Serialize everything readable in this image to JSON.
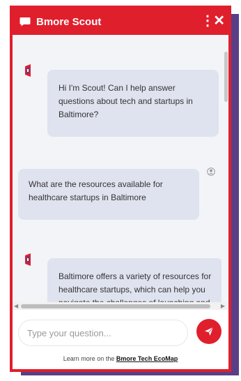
{
  "header": {
    "title": "Bmore Scout",
    "kebab": "⋮",
    "close": "✕",
    "color": "#e01f2d"
  },
  "messages": [
    {
      "role": "bot",
      "text": "Hi I'm Scout! Can I help answer questions about tech and startups in Baltimore?"
    },
    {
      "role": "user",
      "text": "What are the resources available for healthcare startups in Baltimore"
    },
    {
      "role": "bot",
      "text": "Baltimore offers a variety of resources for healthcare startups, which can help you navigate the challenges of launching and"
    }
  ],
  "composer": {
    "placeholder": "Type your question..."
  },
  "footer": {
    "prefix": "Learn more on the ",
    "link": "Bmore Tech EcoMap"
  },
  "icons": {
    "chat": "chat-bubble-icon",
    "bot": "scout-logo-icon",
    "user": "user-avatar-icon",
    "send": "paper-plane-icon"
  }
}
